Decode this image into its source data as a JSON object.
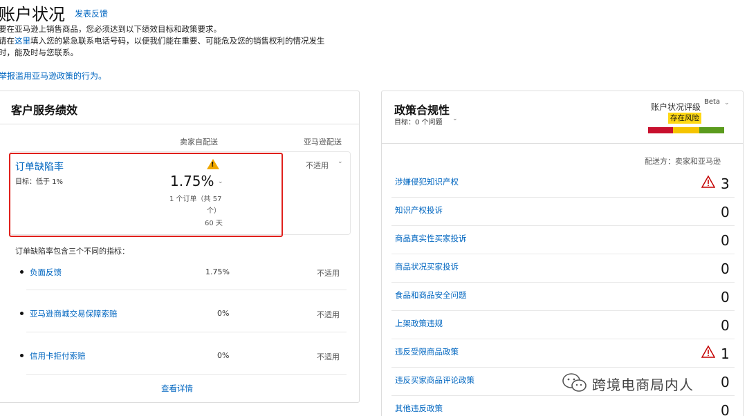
{
  "header": {
    "title": "账户状况",
    "feedback_link": "发表反馈",
    "intro_line1": "要在亚马逊上销售商品，您必须达到以下绩效目标和政策要求。",
    "intro_line2_pre": "请在",
    "intro_line2_link": "这里",
    "intro_line2_post": "填入您的紧急联系电话号码，以便我们能在重要、可能危及您的销售权利的情况发生",
    "intro_line3": "时，能及时与您联系。",
    "report_link": "举报滥用亚马逊政策的行为。"
  },
  "customer_service": {
    "title": "客户服务绩效",
    "col_seller": "卖家自配送",
    "col_amazon": "亚马逊配送",
    "odr": {
      "label": "订单缺陷率",
      "target": "目标：低于 1%",
      "value": "1.75%",
      "orders_line1": "1 个订单（共 57",
      "orders_line2": "个）",
      "period": "60 天",
      "amazon_value": "不适用"
    },
    "includes_text": "订单缺陷率包含三个不同的指标：",
    "metrics": [
      {
        "label": "负面反馈",
        "seller": "1.75%",
        "amazon": "不适用"
      },
      {
        "label": "亚马逊商城交易保障索赔",
        "seller": "0%",
        "amazon": "不适用"
      },
      {
        "label": "信用卡拒付索赔",
        "seller": "0%",
        "amazon": "不适用"
      }
    ],
    "details_link": "查看详情"
  },
  "policy": {
    "title": "政策合规性",
    "target": "目标：0 个问题",
    "rating_label": "账户状况评级",
    "beta": "Beta",
    "risk_badge": "存在风险",
    "risk_colors": [
      "#c8102e",
      "#f5c400",
      "#5b9b1d"
    ],
    "fulfilled_by": "配送方：卖家和亚马逊",
    "items": [
      {
        "label": "涉嫌侵犯知识产权",
        "count": "3",
        "alert": true
      },
      {
        "label": "知识产权投诉",
        "count": "0",
        "alert": false
      },
      {
        "label": "商品真实性买家投诉",
        "count": "0",
        "alert": false
      },
      {
        "label": "商品状况买家投诉",
        "count": "0",
        "alert": false
      },
      {
        "label": "食品和商品安全问题",
        "count": "0",
        "alert": false
      },
      {
        "label": "上架政策违规",
        "count": "0",
        "alert": false
      },
      {
        "label": "违反受限商品政策",
        "count": "1",
        "alert": true
      },
      {
        "label": "违反买家商品评论政策",
        "count": "0",
        "alert": false
      },
      {
        "label": "其他违反政策",
        "count": "0",
        "alert": false
      }
    ]
  },
  "watermark": {
    "text": "跨境电商局内人",
    "icon": "wechat-icon"
  }
}
